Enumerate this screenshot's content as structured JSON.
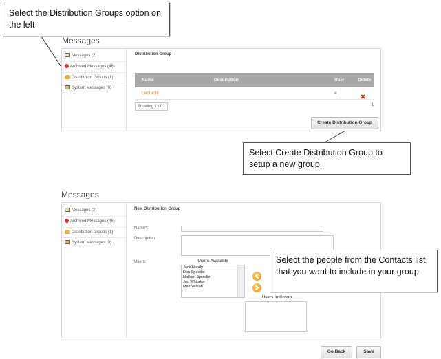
{
  "callouts": {
    "c1": "Select the Distribution Groups option on the left",
    "c2": "Select Create  Distribution Group to setup a new  group.",
    "c3": "Select the people from the Contacts list that you want to include in your group"
  },
  "top": {
    "title": "Messages",
    "sidebar": [
      "Messages (2)",
      "Archived Messages (46)",
      "Distribution Groups (1)",
      "System Messages (0)"
    ],
    "heading": "Distribution Group",
    "table": {
      "headers": [
        "Name",
        "Description",
        "User",
        "Delete"
      ],
      "rows": [
        {
          "name": "Leotech",
          "description": "",
          "users": "4"
        }
      ]
    },
    "showing": "Showing 1 of 1",
    "page": "1",
    "create_button": "Create Distribution Group"
  },
  "bottom": {
    "title": "Messages",
    "sidebar": [
      "Messages (2)",
      "Archived Messages (46)",
      "Distribution Groups (1)",
      "System Messages (0)"
    ],
    "heading": "New Distribution Group",
    "name_label": "Name*:",
    "description_label": "Description:",
    "users_label": "Users:",
    "users_available_label": "Users Available",
    "users_available": [
      "Jack Handy",
      "Don Speedie",
      "Nathan Speedie",
      "Jon Whitaker",
      "Matt Wilson"
    ],
    "users_in_group_label": "Users in Group",
    "go_back_button": "Go Back",
    "save_button": "Save"
  },
  "colors": {
    "accent": "#e07a3c",
    "header_gray": "#a7a7a7",
    "delete_red": "#cc1111",
    "arrow_orange": "#f08a00"
  }
}
